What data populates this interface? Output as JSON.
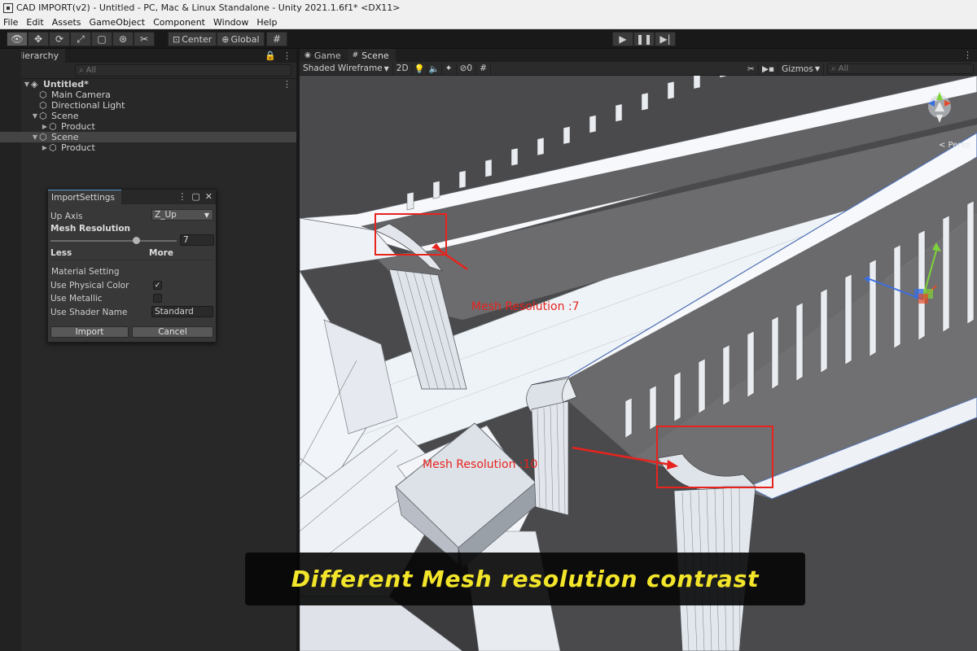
{
  "window": {
    "title": "CAD IMPORT(v2) - Untitled - PC, Mac & Linux Standalone - Unity 2021.1.6f1* <DX11>"
  },
  "menu": [
    "File",
    "Edit",
    "Assets",
    "GameObject",
    "Component",
    "Window",
    "Help"
  ],
  "toolbar": {
    "pivot_label": "Center",
    "space_label": "Global"
  },
  "hierarchy": {
    "tab_label": "Hierarchy",
    "search_placeholder": "All",
    "add_label": "+▾",
    "items": [
      {
        "label": "Untitled*"
      },
      {
        "label": "Main Camera"
      },
      {
        "label": "Directional Light"
      },
      {
        "label": "Scene"
      },
      {
        "label": "Product"
      },
      {
        "label": "Scene"
      },
      {
        "label": "Product"
      }
    ]
  },
  "import_settings": {
    "tab_label": "ImportSettings",
    "up_axis_label": "Up Axis",
    "up_axis_value": "Z_Up",
    "mesh_resolution_label": "Mesh Resolution",
    "mesh_resolution_value": "7",
    "mesh_resolution_fraction": 0.7,
    "less_label": "Less",
    "more_label": "More",
    "material_setting_label": "Material Setting",
    "use_physical_color_label": "Use Physical Color",
    "use_physical_color": true,
    "use_metallic_label": "Use Metallic",
    "use_metallic": false,
    "use_shader_name_label": "Use Shader Name",
    "shader_name_value": "Standard",
    "import_button": "Import",
    "cancel_button": "Cancel"
  },
  "scene": {
    "game_tab": "Game",
    "scene_tab": "Scene",
    "shading_mode": "Shaded Wireframe",
    "mode_2d": "2D",
    "hidden_count": "0",
    "gizmos_label": "Gizmos",
    "search_placeholder": "All",
    "persp_label": "< Persp"
  },
  "annotations": {
    "res7_label": "Mesh Resolution :7",
    "res10_label": "Mesh Resolution :10",
    "color": "#e8231d"
  },
  "caption": {
    "text": "Different Mesh resolution contrast",
    "color": "#f2e52a"
  }
}
